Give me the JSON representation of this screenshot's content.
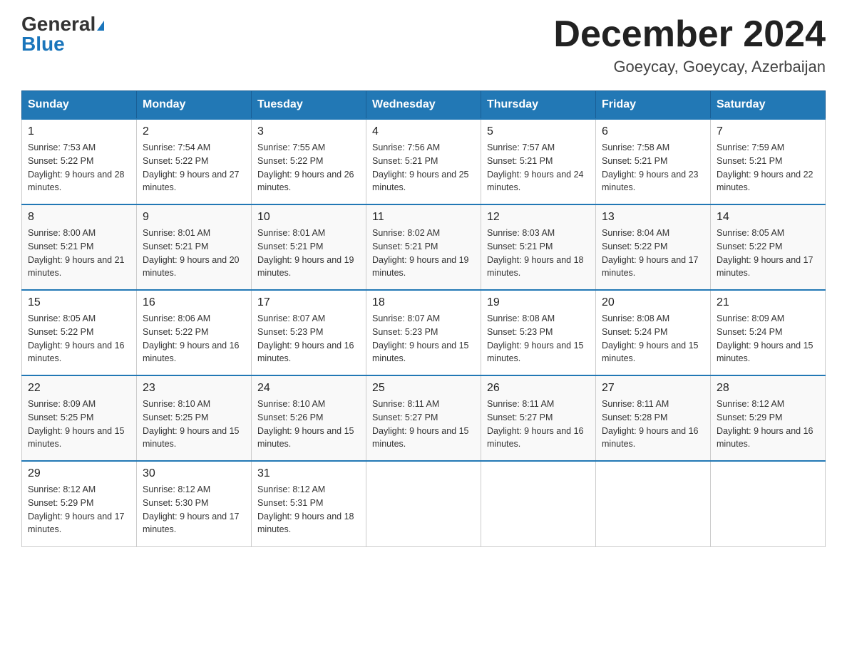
{
  "header": {
    "logo_general": "General",
    "logo_blue": "Blue",
    "month_title": "December 2024",
    "location": "Goeycay, Goeycay, Azerbaijan"
  },
  "days_of_week": [
    "Sunday",
    "Monday",
    "Tuesday",
    "Wednesday",
    "Thursday",
    "Friday",
    "Saturday"
  ],
  "weeks": [
    [
      {
        "day": "1",
        "sunrise": "7:53 AM",
        "sunset": "5:22 PM",
        "daylight": "9 hours and 28 minutes."
      },
      {
        "day": "2",
        "sunrise": "7:54 AM",
        "sunset": "5:22 PM",
        "daylight": "9 hours and 27 minutes."
      },
      {
        "day": "3",
        "sunrise": "7:55 AM",
        "sunset": "5:22 PM",
        "daylight": "9 hours and 26 minutes."
      },
      {
        "day": "4",
        "sunrise": "7:56 AM",
        "sunset": "5:21 PM",
        "daylight": "9 hours and 25 minutes."
      },
      {
        "day": "5",
        "sunrise": "7:57 AM",
        "sunset": "5:21 PM",
        "daylight": "9 hours and 24 minutes."
      },
      {
        "day": "6",
        "sunrise": "7:58 AM",
        "sunset": "5:21 PM",
        "daylight": "9 hours and 23 minutes."
      },
      {
        "day": "7",
        "sunrise": "7:59 AM",
        "sunset": "5:21 PM",
        "daylight": "9 hours and 22 minutes."
      }
    ],
    [
      {
        "day": "8",
        "sunrise": "8:00 AM",
        "sunset": "5:21 PM",
        "daylight": "9 hours and 21 minutes."
      },
      {
        "day": "9",
        "sunrise": "8:01 AM",
        "sunset": "5:21 PM",
        "daylight": "9 hours and 20 minutes."
      },
      {
        "day": "10",
        "sunrise": "8:01 AM",
        "sunset": "5:21 PM",
        "daylight": "9 hours and 19 minutes."
      },
      {
        "day": "11",
        "sunrise": "8:02 AM",
        "sunset": "5:21 PM",
        "daylight": "9 hours and 19 minutes."
      },
      {
        "day": "12",
        "sunrise": "8:03 AM",
        "sunset": "5:21 PM",
        "daylight": "9 hours and 18 minutes."
      },
      {
        "day": "13",
        "sunrise": "8:04 AM",
        "sunset": "5:22 PM",
        "daylight": "9 hours and 17 minutes."
      },
      {
        "day": "14",
        "sunrise": "8:05 AM",
        "sunset": "5:22 PM",
        "daylight": "9 hours and 17 minutes."
      }
    ],
    [
      {
        "day": "15",
        "sunrise": "8:05 AM",
        "sunset": "5:22 PM",
        "daylight": "9 hours and 16 minutes."
      },
      {
        "day": "16",
        "sunrise": "8:06 AM",
        "sunset": "5:22 PM",
        "daylight": "9 hours and 16 minutes."
      },
      {
        "day": "17",
        "sunrise": "8:07 AM",
        "sunset": "5:23 PM",
        "daylight": "9 hours and 16 minutes."
      },
      {
        "day": "18",
        "sunrise": "8:07 AM",
        "sunset": "5:23 PM",
        "daylight": "9 hours and 15 minutes."
      },
      {
        "day": "19",
        "sunrise": "8:08 AM",
        "sunset": "5:23 PM",
        "daylight": "9 hours and 15 minutes."
      },
      {
        "day": "20",
        "sunrise": "8:08 AM",
        "sunset": "5:24 PM",
        "daylight": "9 hours and 15 minutes."
      },
      {
        "day": "21",
        "sunrise": "8:09 AM",
        "sunset": "5:24 PM",
        "daylight": "9 hours and 15 minutes."
      }
    ],
    [
      {
        "day": "22",
        "sunrise": "8:09 AM",
        "sunset": "5:25 PM",
        "daylight": "9 hours and 15 minutes."
      },
      {
        "day": "23",
        "sunrise": "8:10 AM",
        "sunset": "5:25 PM",
        "daylight": "9 hours and 15 minutes."
      },
      {
        "day": "24",
        "sunrise": "8:10 AM",
        "sunset": "5:26 PM",
        "daylight": "9 hours and 15 minutes."
      },
      {
        "day": "25",
        "sunrise": "8:11 AM",
        "sunset": "5:27 PM",
        "daylight": "9 hours and 15 minutes."
      },
      {
        "day": "26",
        "sunrise": "8:11 AM",
        "sunset": "5:27 PM",
        "daylight": "9 hours and 16 minutes."
      },
      {
        "day": "27",
        "sunrise": "8:11 AM",
        "sunset": "5:28 PM",
        "daylight": "9 hours and 16 minutes."
      },
      {
        "day": "28",
        "sunrise": "8:12 AM",
        "sunset": "5:29 PM",
        "daylight": "9 hours and 16 minutes."
      }
    ],
    [
      {
        "day": "29",
        "sunrise": "8:12 AM",
        "sunset": "5:29 PM",
        "daylight": "9 hours and 17 minutes."
      },
      {
        "day": "30",
        "sunrise": "8:12 AM",
        "sunset": "5:30 PM",
        "daylight": "9 hours and 17 minutes."
      },
      {
        "day": "31",
        "sunrise": "8:12 AM",
        "sunset": "5:31 PM",
        "daylight": "9 hours and 18 minutes."
      },
      null,
      null,
      null,
      null
    ]
  ]
}
